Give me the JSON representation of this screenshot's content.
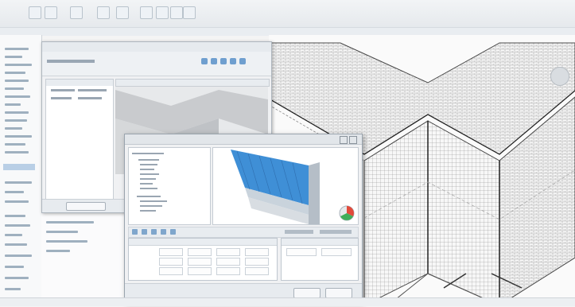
{
  "app": {
    "title": ""
  },
  "ribbon": {
    "buttons": [
      "",
      "",
      "",
      "",
      "",
      "",
      "",
      "",
      ""
    ]
  },
  "browser": {
    "items": []
  },
  "dialog_back": {
    "title": "",
    "columns": []
  },
  "dialog_front": {
    "title": "",
    "ok_label": "",
    "cancel_label": ""
  },
  "status": {
    "text": ""
  },
  "colors": {
    "facade_blue": "#3f8fd6",
    "ribbon_bg": "#e6eaee",
    "panel_bg": "#f0f1f3",
    "selection": "#b9cfe6"
  }
}
